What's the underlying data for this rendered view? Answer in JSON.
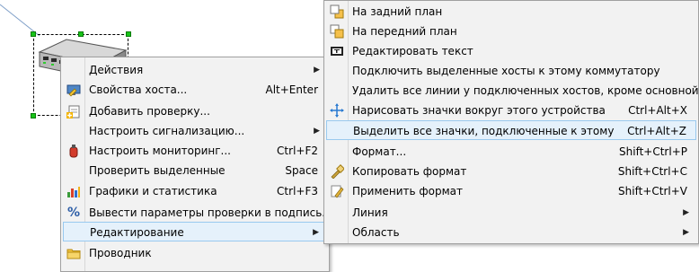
{
  "left_menu": {
    "items": [
      {
        "label": "Действия",
        "shortcut": "",
        "submenu": true,
        "icon": ""
      },
      {
        "label": "Свойства хоста...",
        "shortcut": "Alt+Enter",
        "submenu": false,
        "icon": "host-properties-icon"
      },
      {
        "label": "Добавить проверку...",
        "shortcut": "",
        "submenu": false,
        "icon": "add-check-icon"
      },
      {
        "label": "Настроить сигнализацию...",
        "shortcut": "",
        "submenu": true,
        "icon": ""
      },
      {
        "label": "Настроить мониторинг...",
        "shortcut": "Ctrl+F2",
        "submenu": false,
        "icon": "monitoring-icon"
      },
      {
        "label": "Проверить выделенные",
        "shortcut": "Space",
        "submenu": false,
        "icon": ""
      },
      {
        "label": "Графики и статистика",
        "shortcut": "Ctrl+F3",
        "submenu": false,
        "icon": "charts-icon"
      },
      {
        "label": "Вывести параметры проверки в подпись...",
        "shortcut": "",
        "submenu": false,
        "icon": "percent-icon"
      },
      {
        "label": "Редактирование",
        "shortcut": "",
        "submenu": true,
        "icon": "",
        "highlighted": true
      },
      {
        "label": "Проводник",
        "shortcut": "",
        "submenu": false,
        "icon": "explorer-folder-icon"
      }
    ]
  },
  "right_menu": {
    "items": [
      {
        "label": "На задний план",
        "shortcut": "",
        "submenu": false,
        "icon": "send-to-back-icon"
      },
      {
        "label": "На передний план",
        "shortcut": "",
        "submenu": false,
        "icon": "bring-to-front-icon"
      },
      {
        "label": "Редактировать текст",
        "shortcut": "",
        "submenu": false,
        "icon": "edit-text-icon"
      },
      {
        "label": "Подключить выделенные хосты к этому коммутатору",
        "shortcut": "",
        "submenu": false,
        "icon": ""
      },
      {
        "label": "Удалить все линии у подключенных хостов, кроме основной",
        "shortcut": "",
        "submenu": false,
        "icon": ""
      },
      {
        "label": "Нарисовать значки вокруг этого устройства",
        "shortcut": "Ctrl+Alt+X",
        "submenu": false,
        "icon": "arrange-around-icon"
      },
      {
        "label": "Выделить все значки, подключенные к этому",
        "shortcut": "Ctrl+Alt+Z",
        "submenu": false,
        "icon": "",
        "highlighted": true
      },
      {
        "label": "Формат...",
        "shortcut": "Shift+Ctrl+P",
        "submenu": false,
        "icon": ""
      },
      {
        "label": "Копировать формат",
        "shortcut": "Shift+Ctrl+C",
        "submenu": false,
        "icon": "copy-format-icon"
      },
      {
        "label": "Применить формат",
        "shortcut": "Shift+Ctrl+V",
        "submenu": false,
        "icon": "apply-format-icon"
      },
      {
        "label": "Линия",
        "shortcut": "",
        "submenu": true,
        "icon": ""
      },
      {
        "label": "Область",
        "shortcut": "",
        "submenu": true,
        "icon": ""
      }
    ]
  },
  "canvas": {
    "peek_text": "@",
    "device_icon": "network-switch-icon"
  },
  "colors": {
    "menu_bg": "#f2f2f2",
    "highlight_bg": "#e5f1fb",
    "highlight_border": "#99c9ef",
    "handle": "#18c418"
  }
}
